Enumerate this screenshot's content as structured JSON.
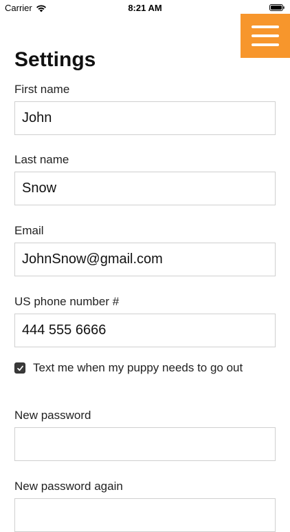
{
  "status_bar": {
    "carrier": "Carrier",
    "time": "8:21 AM"
  },
  "header": {
    "title": "Settings",
    "menu_icon": "hamburger-icon",
    "menu_color": "#f7962c"
  },
  "form": {
    "first_name": {
      "label": "First name",
      "value": "John"
    },
    "last_name": {
      "label": "Last name",
      "value": "Snow"
    },
    "email": {
      "label": "Email",
      "value": "JohnSnow@gmail.com"
    },
    "phone": {
      "label": "US phone number #",
      "value": "444 555 6666"
    },
    "text_me": {
      "label": "Text me when my puppy needs to go out",
      "checked": true
    },
    "new_password": {
      "label": "New password",
      "value": ""
    },
    "new_password_again": {
      "label": "New password again",
      "value": ""
    }
  }
}
